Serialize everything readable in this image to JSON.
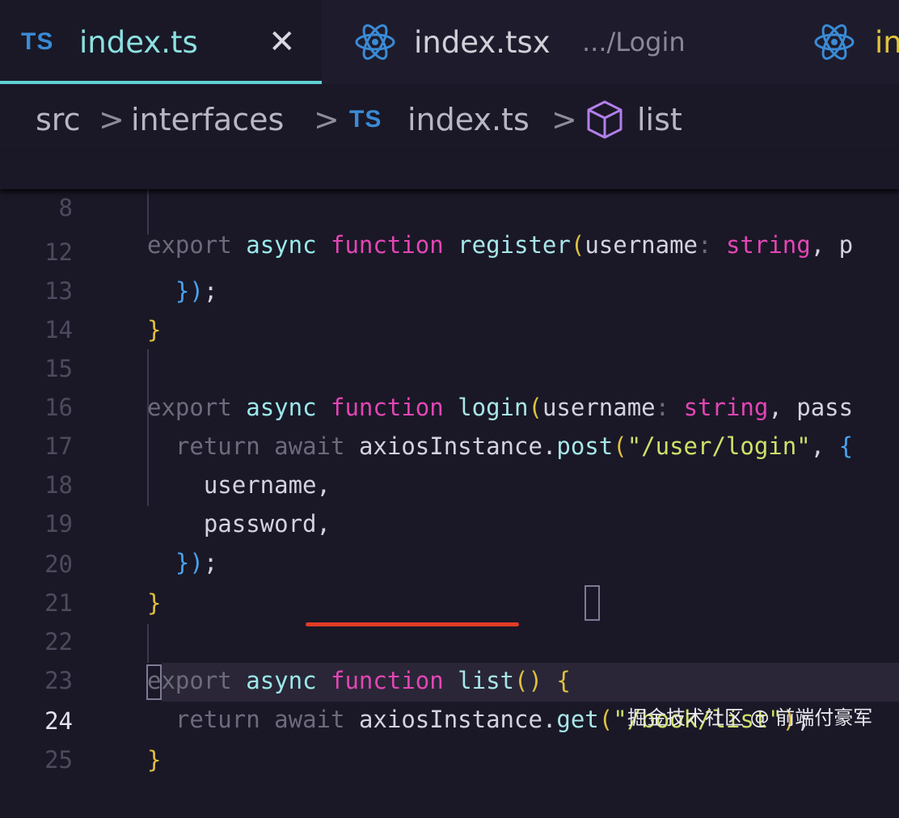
{
  "tabs": [
    {
      "icon": "TS",
      "label": "index.ts",
      "close": "✕",
      "active": true
    },
    {
      "icon": "react-icon",
      "label": "index.tsx",
      "description": ".../Login"
    },
    {
      "icon": "react-icon",
      "label": "in"
    }
  ],
  "breadcrumb": {
    "items": [
      "src",
      "interfaces",
      "index.ts",
      "list"
    ],
    "file_icon": "TS",
    "symbol_icon": "cube-icon",
    "separator": ">"
  },
  "code": {
    "active_line": "24",
    "sticky_line": {
      "num": "8",
      "tokens": {
        "t1": "export",
        "t2": "async",
        "t3": "function",
        "t4": "register",
        "t5": "(",
        "t6": "username",
        "t7": ":",
        "t8": "string",
        "t9": ", p"
      }
    },
    "lines": [
      {
        "num": "12",
        "tokens": {
          "t1": "})",
          "t2": ";"
        }
      },
      {
        "num": "13",
        "tokens": {
          "t1": "}"
        }
      },
      {
        "num": "14"
      },
      {
        "num": "15",
        "tokens": {
          "t1": "export",
          "t2": "async",
          "t3": "function",
          "t4": "login",
          "t5": "(",
          "t6": "username",
          "t7": ":",
          "t8": "string",
          "t9": ", pass"
        }
      },
      {
        "num": "16",
        "tokens": {
          "t1": "return",
          "t2": "await",
          "t3": "axiosInstance.",
          "t4": "post",
          "t5": "(",
          "t6": "\"/user/login\"",
          "t7": ",",
          "t8": "{"
        }
      },
      {
        "num": "17",
        "tokens": {
          "t1": "username,"
        }
      },
      {
        "num": "18",
        "tokens": {
          "t1": "password,"
        }
      },
      {
        "num": "19",
        "tokens": {
          "t1": "})",
          "t2": ";"
        }
      },
      {
        "num": "20",
        "tokens": {
          "t1": "}"
        }
      },
      {
        "num": "21"
      },
      {
        "num": "22",
        "tokens": {
          "t1": "export",
          "t2": "async",
          "t3": "function",
          "t4": "list",
          "t5": "()",
          "t6": "{"
        }
      },
      {
        "num": "23",
        "tokens": {
          "t1": "return",
          "t2": "await",
          "t3": "axiosInstance.",
          "t4": "get",
          "t5": "(",
          "t6": "\"/book/list\"",
          "t7": ")",
          "t8": ";"
        }
      },
      {
        "num": "24",
        "tokens": {
          "t1": "}"
        }
      },
      {
        "num": "25"
      }
    ]
  },
  "watermark": "掘金技术社区 @ 前端付豪军",
  "colors": {
    "background": "#1a1827",
    "keyword_pink": "#e246b4",
    "string_green": "#cfe06a",
    "accent_cyan": "#5fd0d5",
    "underline_red": "#e23c25"
  }
}
